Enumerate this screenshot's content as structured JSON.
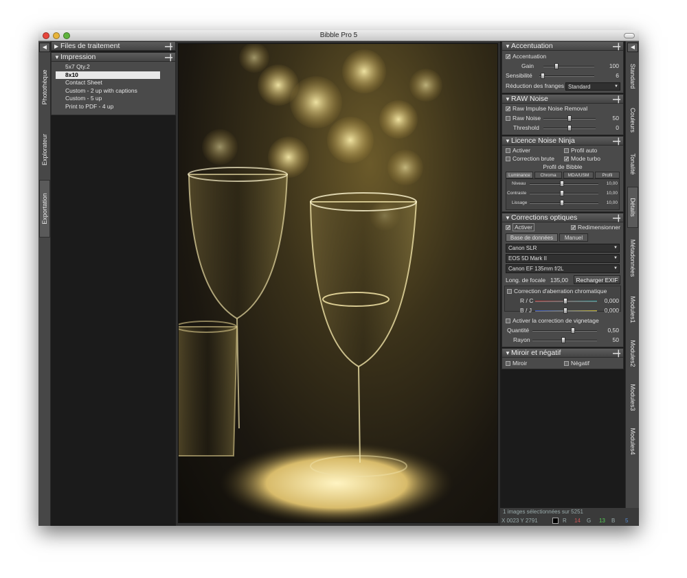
{
  "window": {
    "title": "Bibble Pro 5"
  },
  "left_tabs": [
    "Photothèque",
    "Explorateur",
    "Exportation"
  ],
  "left_panel": {
    "files_header": "Files de traitement",
    "print_header": "Impression",
    "items": [
      "5x7 Qty.2",
      "8x10",
      "Contact Sheet",
      "Custom - 2 up with captions",
      "Custom - 5 up",
      "Print to PDF - 4 up"
    ],
    "selected_item": "8x10"
  },
  "right_tabs": [
    "Standard",
    "Couleurs",
    "Tonalité",
    "Détails",
    "Métadonnées",
    "Modules1",
    "Modules2",
    "Modules3",
    "Modules4"
  ],
  "sharpening": {
    "header": "Accentuation",
    "enable_label": "Accentuation",
    "gain_label": "Gain",
    "gain_value": "100",
    "gain_level": 0.25,
    "sensitivity_label": "Sensibilité",
    "sensitivity_value": "6",
    "sensitivity_level": 0.06,
    "fringe_label": "Réduction des franges",
    "fringe_value": "Standard"
  },
  "raw_noise": {
    "header": "RAW Noise",
    "impulse_label": "Raw Impulse Noise Removal",
    "raw_noise_label": "Raw Noise",
    "raw_noise_value": "50",
    "raw_noise_level": 0.5,
    "threshold_label": "Threshold",
    "threshold_value": "0",
    "threshold_level": 0.5
  },
  "noise_ninja": {
    "header": "Licence Noise Ninja",
    "activate_label": "Activer",
    "auto_profile_label": "Profil auto",
    "raw_correction_label": "Correction brute",
    "turbo_label": "Mode turbo",
    "profile_label": "Profil de Bibble",
    "tabs": [
      "Luminance",
      "Chroma",
      "MDA/USM",
      "Profil"
    ],
    "level_label": "Niveau",
    "level_value": "10,00",
    "contrast_label": "Contraste",
    "contrast_value": "10,00",
    "smoothing_label": "Lissage",
    "smoothing_value": "10,00"
  },
  "optics": {
    "header": "Corrections optiques",
    "activate_label": "Activer",
    "resize_label": "Redimensionner",
    "tab_database": "Base de données",
    "tab_manual": "Manuel",
    "maker": "Canon SLR",
    "body": "EOS 5D Mark II",
    "lens": "Canon EF 135mm f/2L",
    "focal_label": "Long. de focale",
    "focal_value": "135,00",
    "reload_exif": "Recharger EXIF",
    "ca_label": "Correction d'aberration chromatique",
    "rc_label": "R / C",
    "rc_value": "0,000",
    "by_label": "B / J",
    "by_value": "0,000",
    "vignette_label": "Activer la correction de vignetage",
    "amount_label": "Quantité",
    "amount_value": "0,50",
    "radius_label": "Rayon",
    "radius_value": "50"
  },
  "mirror": {
    "header": "Miroir et négatif",
    "mirror_label": "Miroir",
    "negative_label": "Négatif"
  },
  "status": {
    "selection": "1 images sélectionnées sur 5251",
    "coords": "X 0023  Y 2791",
    "r_label": "R",
    "r_value": "14",
    "g_label": "G",
    "g_value": "13",
    "b_label": "B",
    "b_value": "5"
  }
}
